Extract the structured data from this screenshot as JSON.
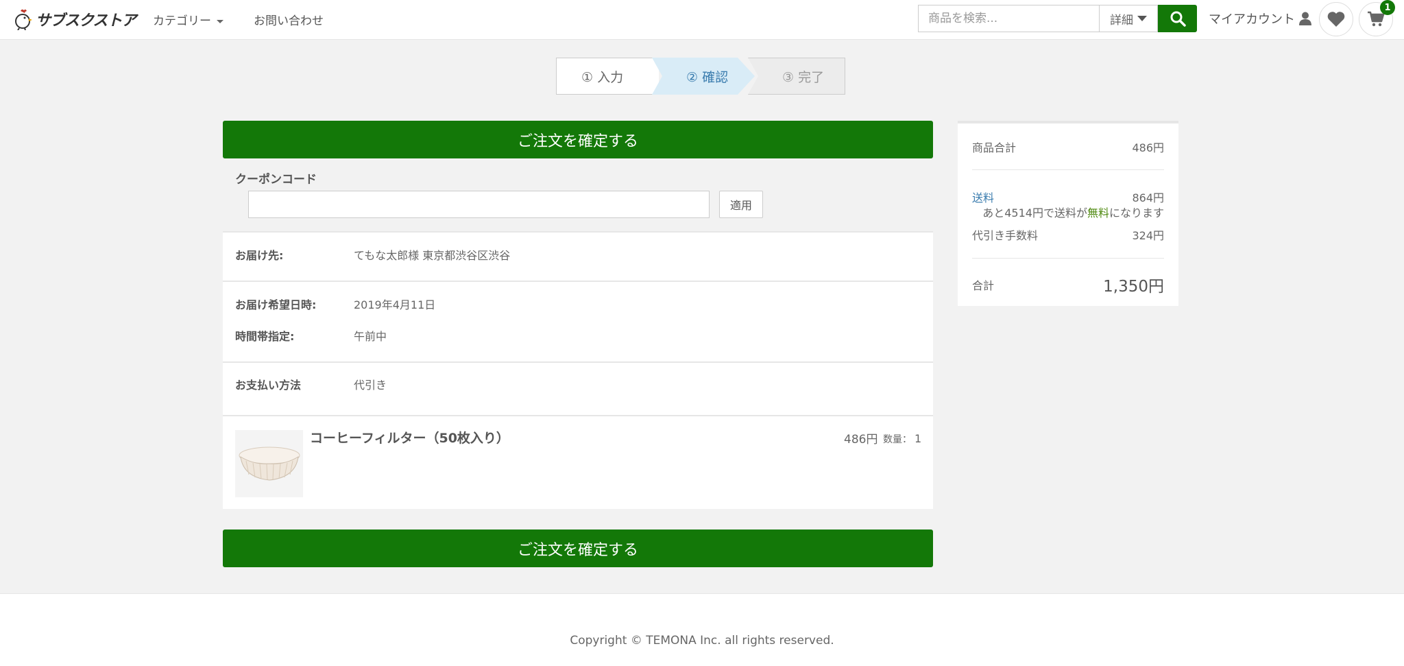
{
  "header": {
    "logo_text": "サブスクストア",
    "nav_category": "カテゴリー",
    "nav_contact": "お問い合わせ",
    "search_placeholder": "商品を検索...",
    "detail_label": "詳細",
    "account_label": "マイアカウント",
    "cart_count": "1",
    "brand_color": "#137808"
  },
  "steps": [
    {
      "label": "① 入力"
    },
    {
      "label": "② 確認"
    },
    {
      "label": "③ 完了"
    }
  ],
  "main": {
    "confirm_label": "ご注文を確定する",
    "coupon_label": "クーポンコード",
    "coupon_value": "",
    "apply_label": "適用",
    "delivery_label": "お届け先:",
    "delivery_value": "てもな太郎様 東京都渋谷区渋谷",
    "date_label": "お届け希望日時:",
    "date_value": "2019年4月11日",
    "time_label": "時間帯指定:",
    "time_value": "午前中",
    "payment_label": "お支払い方法",
    "payment_value": "代引き",
    "product": {
      "name": "コーヒーフィルター（50枚入り）",
      "price": "486円",
      "qty_label": "数量：",
      "qty": "1"
    }
  },
  "summary": {
    "subtotal_label": "商品合計",
    "subtotal_value": "486円",
    "shipping_label": "送料",
    "shipping_value": "864円",
    "ship_note_pre": "あと4514円で送料が",
    "ship_note_free": "無料",
    "ship_note_post": "になります",
    "cod_label": "代引き手数料",
    "cod_value": "324円",
    "total_label": "合計",
    "total_value": "1,350円"
  },
  "footer": {
    "copyright": "Copyright © TEMONA Inc. all rights reserved."
  }
}
